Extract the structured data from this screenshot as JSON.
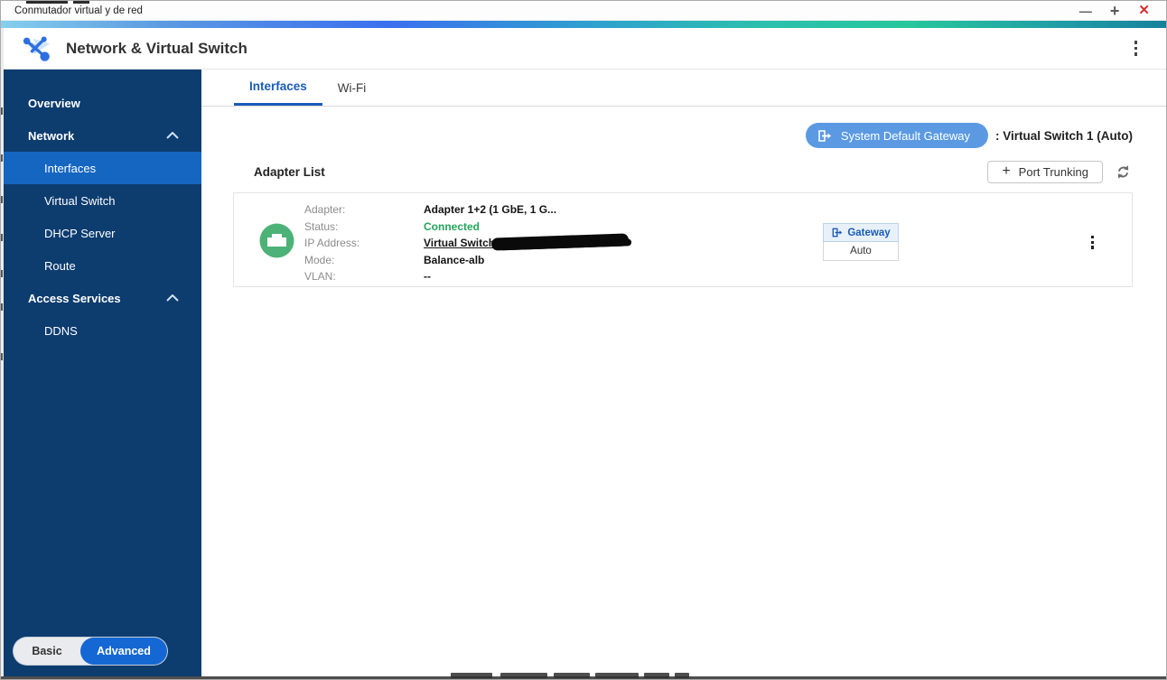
{
  "window": {
    "title": "Conmutador virtual y de red",
    "controls": {
      "minimize": "—",
      "maximize": "+",
      "close": "✕"
    }
  },
  "app_header": {
    "title": "Network & Virtual Switch"
  },
  "sidebar": {
    "items": [
      {
        "label": "Overview"
      },
      {
        "label": "Network"
      },
      {
        "label": "Interfaces"
      },
      {
        "label": "Virtual Switch"
      },
      {
        "label": "DHCP Server"
      },
      {
        "label": "Route"
      },
      {
        "label": "Access Services"
      },
      {
        "label": "DDNS"
      }
    ],
    "toggle": {
      "basic": "Basic",
      "advanced": "Advanced",
      "active": "Advanced"
    }
  },
  "tabs": {
    "interfaces": "Interfaces",
    "wifi": "Wi-Fi"
  },
  "gateway_bar": {
    "button": "System Default Gateway",
    "value": ": Virtual Switch 1 (Auto)"
  },
  "adapter_section": {
    "heading": "Adapter List",
    "plus": "+",
    "port_trunking": "Port Trunking"
  },
  "adapter": {
    "rows": [
      {
        "label": "Adapter:",
        "value": "Adapter 1+2 (1 GbE, 1 G..."
      },
      {
        "label": "Status:",
        "value": "Connected"
      },
      {
        "label": "IP Address:",
        "value": "Virtual Switch",
        "redacted": true
      },
      {
        "label": "Mode:",
        "value": "Balance-alb"
      },
      {
        "label": "VLAN:",
        "value": "--"
      }
    ],
    "gateway_button": "Gateway",
    "auto_button": "Auto"
  },
  "colors": {
    "sidebar_bg": "#0d3c6f",
    "sidebar_selected": "#1566c1",
    "accent_blue": "#1a5cb8",
    "gateway_pill": "#5b9ae2",
    "toggle_advanced": "#1568d3",
    "status_connected": "#22a55b",
    "adapter_icon_green": "#4cb277",
    "close_red": "#d4302e",
    "gradient_stops": [
      "#85cfed",
      "#3c6fef",
      "#2bbfae",
      "#27c79c",
      "#17819b"
    ]
  }
}
